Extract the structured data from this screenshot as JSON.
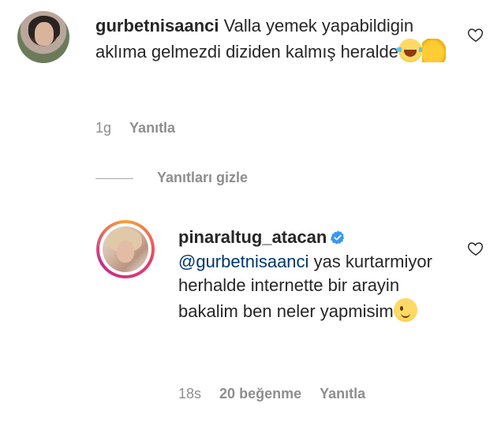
{
  "comments": [
    {
      "username": "gurbetnisaanci",
      "text": "Valla yemek yapabildigin aklıma gelmezdi diziden kalmış heralde",
      "emojis": [
        "face-with-tears-of-joy",
        "clapping-hands"
      ],
      "time": "1g",
      "reply_label": "Yanıtla"
    },
    {
      "username": "pinaraltug_atacan",
      "mention": "@gurbetnisaanci",
      "text": "yas kurtarmiyor herhalde internette bir arayin bakalim ben neler yapmisim",
      "emojis": [
        "winking-face"
      ],
      "time": "18s",
      "likes": "20 beğenme",
      "reply_label": "Yanıtla"
    }
  ],
  "hide_replies_label": "Yanıtları gizle",
  "colors": {
    "text": "#262626",
    "meta": "#8e8e8e",
    "mention": "#00376b",
    "verified": "#3897f0"
  }
}
